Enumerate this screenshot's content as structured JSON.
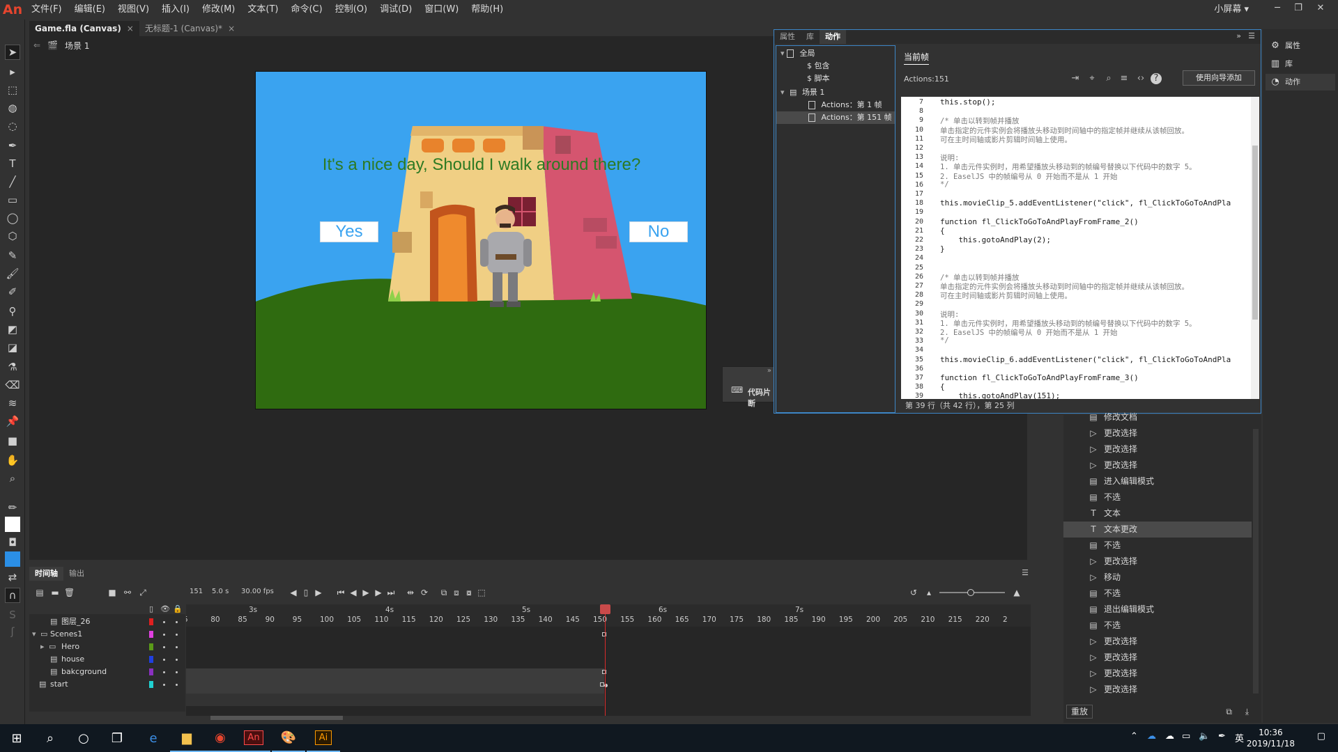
{
  "app": {
    "logo": "An",
    "workspace": "小屏幕 ▾"
  },
  "menu": [
    "文件(F)",
    "编辑(E)",
    "视图(V)",
    "插入(I)",
    "修改(M)",
    "文本(T)",
    "命令(C)",
    "控制(O)",
    "调试(D)",
    "窗口(W)",
    "帮助(H)"
  ],
  "doc_tabs": [
    {
      "label": "Game.fla (Canvas)",
      "close": "×"
    },
    {
      "label": "无标题-1 (Canvas)*",
      "close": "×"
    }
  ],
  "scene": {
    "name": "场景 1"
  },
  "stage": {
    "question": "It's a nice day, Should I walk around there?",
    "yes": "Yes",
    "no": "No",
    "sky_color": "#3aa3f0",
    "grass_color": "#2f6b10"
  },
  "snippets": {
    "label": "代码片断"
  },
  "actions_panel": {
    "tabs": [
      "属性",
      "库",
      "动作"
    ],
    "tree": [
      {
        "label": "全局"
      },
      {
        "label": "包含"
      },
      {
        "label": "脚本"
      },
      {
        "label": "场景 1"
      },
      {
        "label": "Actions：第 1 帧"
      },
      {
        "label": "Actions：第 151 帧"
      }
    ],
    "current_frame_tab": "当前帧",
    "actions_label": "Actions:151",
    "wizard_button": "使用向导添加",
    "status": "第 39 行（共 42 行），第 25 列",
    "code_lines": [
      {
        "n": "7",
        "t": "this.stop();"
      },
      {
        "n": "8",
        "t": ""
      },
      {
        "n": "9",
        "t": "/* 单击以转到帧并播放"
      },
      {
        "n": "10",
        "t": "单击指定的元件实例会将播放头移动到时间轴中的指定帧并继续从该帧回放。"
      },
      {
        "n": "11",
        "t": "可在主时间轴或影片剪辑时间轴上使用。"
      },
      {
        "n": "12",
        "t": ""
      },
      {
        "n": "13",
        "t": "说明:"
      },
      {
        "n": "14",
        "t": "1. 单击元件实例时，用希望播放头移动到的帧编号替换以下代码中的数字 5。"
      },
      {
        "n": "15",
        "t": "2. EaselJS 中的帧编号从 0 开始而不是从 1 开始"
      },
      {
        "n": "16",
        "t": "*/"
      },
      {
        "n": "17",
        "t": ""
      },
      {
        "n": "18",
        "t": "this.movieClip_5.addEventListener(\"click\", fl_ClickToGoToAndPla"
      },
      {
        "n": "19",
        "t": ""
      },
      {
        "n": "20",
        "t": "function fl_ClickToGoToAndPlayFromFrame_2()"
      },
      {
        "n": "21",
        "t": "{"
      },
      {
        "n": "22",
        "t": "    this.gotoAndPlay(2);"
      },
      {
        "n": "23",
        "t": "}"
      },
      {
        "n": "24",
        "t": ""
      },
      {
        "n": "25",
        "t": ""
      },
      {
        "n": "26",
        "t": "/* 单击以转到帧并播放"
      },
      {
        "n": "27",
        "t": "单击指定的元件实例会将播放头移动到时间轴中的指定帧并继续从该帧回放。"
      },
      {
        "n": "28",
        "t": "可在主时间轴或影片剪辑时间轴上使用。"
      },
      {
        "n": "29",
        "t": ""
      },
      {
        "n": "30",
        "t": "说明:"
      },
      {
        "n": "31",
        "t": "1. 单击元件实例时，用希望播放头移动到的帧编号替换以下代码中的数字 5。"
      },
      {
        "n": "32",
        "t": "2. EaselJS 中的帧编号从 0 开始而不是从 1 开始"
      },
      {
        "n": "33",
        "t": "*/"
      },
      {
        "n": "34",
        "t": ""
      },
      {
        "n": "35",
        "t": "this.movieClip_6.addEventListener(\"click\", fl_ClickToGoToAndPla"
      },
      {
        "n": "36",
        "t": ""
      },
      {
        "n": "37",
        "t": "function fl_ClickToGoToAndPlayFromFrame_3()"
      },
      {
        "n": "38",
        "t": "{"
      },
      {
        "n": "39",
        "t": "    this.gotoAndPlay(151);"
      }
    ]
  },
  "right_dock": [
    "属性",
    "库",
    "动作"
  ],
  "history": {
    "items": [
      "修改文档",
      "更改选择",
      "更改选择",
      "更改选择",
      "进入编辑模式",
      "不选",
      "文本",
      "文本更改",
      "不选",
      "更改选择",
      "移动",
      "不选",
      "退出编辑模式",
      "不选",
      "更改选择",
      "更改选择",
      "更改选择",
      "更改选择"
    ],
    "replay": "重放"
  },
  "timeline": {
    "tabs": [
      "时间轴",
      "输出"
    ],
    "frame": "151",
    "time": "5.0 s",
    "fps": "30.00 fps",
    "seconds": [
      "3s",
      "4s",
      "5s",
      "6s",
      "7s"
    ],
    "ticks": [
      "5",
      "80",
      "85",
      "90",
      "95",
      "100",
      "105",
      "110",
      "115",
      "120",
      "125",
      "130",
      "135",
      "140",
      "145",
      "150",
      "155",
      "160",
      "165",
      "170",
      "175",
      "180",
      "185",
      "190",
      "195",
      "200",
      "205",
      "210",
      "215",
      "220",
      "2"
    ],
    "layers": [
      {
        "name": "图层_26",
        "color": "#e02020"
      },
      {
        "name": "Scenes1",
        "color": "#e040e0"
      },
      {
        "name": "Hero",
        "color": "#5a9a18"
      },
      {
        "name": "house",
        "color": "#2040e0"
      },
      {
        "name": "bakcground",
        "color": "#8a30c0"
      },
      {
        "name": "start",
        "color": "#20d0d0"
      }
    ]
  },
  "taskbar": {
    "time": "10:36",
    "date": "2019/11/18",
    "ime": "英"
  }
}
